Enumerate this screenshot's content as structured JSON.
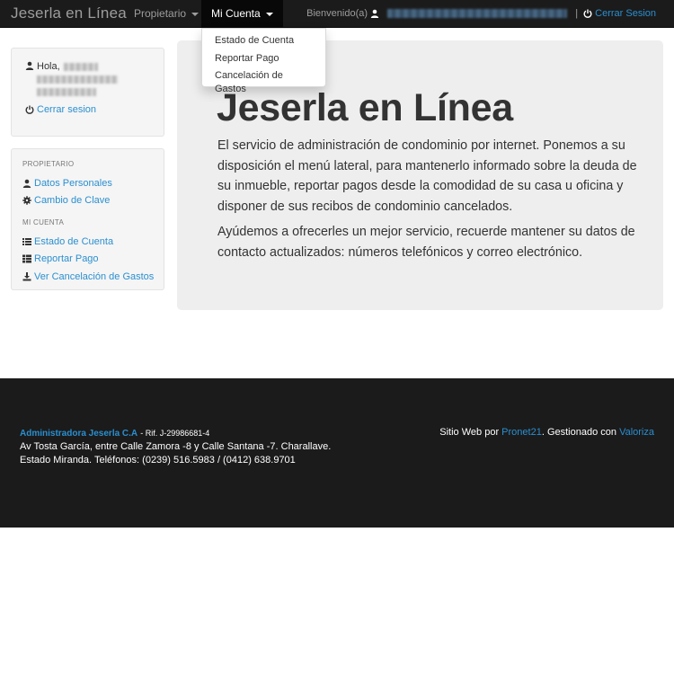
{
  "navbar": {
    "brand": "Jeserla en Línea",
    "propietario_label": "Propietario",
    "micuenta_label": "Mi Cuenta",
    "bienvenido_label": "Bienvenido(a)",
    "separator": "|",
    "logout_label": "Cerrar Sesion"
  },
  "dropdown": {
    "items": [
      "Estado de Cuenta",
      "Reportar Pago",
      "Cancelación de Gastos"
    ]
  },
  "sidebar": {
    "hola_label": "Hola,",
    "logout_label": "Cerrar sesion",
    "sections": [
      {
        "header": "PROPIETARIO",
        "items": [
          {
            "label": "Datos Personales",
            "icon": "user-icon"
          },
          {
            "label": "Cambio de Clave",
            "icon": "gear-icon"
          }
        ]
      },
      {
        "header": "MI CUENTA",
        "items": [
          {
            "label": "Estado de Cuenta",
            "icon": "list-icon"
          },
          {
            "label": "Reportar Pago",
            "icon": "th-list-icon"
          },
          {
            "label": "Ver Cancelación de Gastos",
            "icon": "download-icon"
          }
        ]
      }
    ]
  },
  "jumbotron": {
    "title": "Jeserla en Línea",
    "paragraph1": "El servicio de administración de condominio por internet. Ponemos a su disposición el menú lateral, para mantenerlo informado sobre la deuda de su inmueble, reportar pagos desde la comodidad de su casa u oficina y disponer de sus recibos de condominio cancelados.",
    "paragraph2": "Ayúdemos a ofrecerles un mejor servicio, recuerde mantener su datos de contacto actualizados: números telefónicos y correo electrónico."
  },
  "footer": {
    "company": "Administradora Jeserla C.A",
    "rif": "- Rif. J-29986681-4",
    "address_line1": "Av Tosta García, entre Calle Zamora -8 y Calle Santana -7. Charallave.",
    "address_line2": "Estado Miranda. Teléfonos: (0239) 516.5983 / (0412) 638.9701",
    "credit_prefix": "Sitio Web por",
    "credit_pronet": "Pronet21",
    "credit_middle": ". Gestionado con",
    "credit_valoriza": "Valoriza"
  },
  "colors": {
    "navbar_bg": "#1b1b1b",
    "link": "#2a8fd0",
    "jumbotron_bg": "#eeeeee",
    "footer_bg": "#1b1b1b"
  }
}
